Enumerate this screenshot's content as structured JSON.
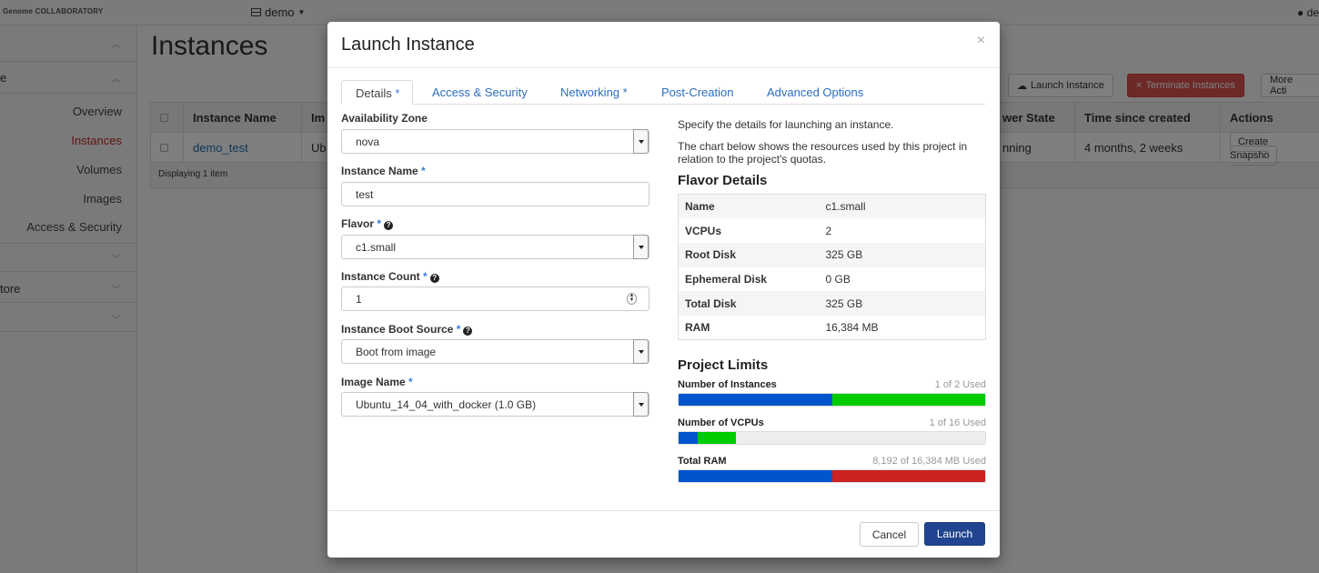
{
  "topbar": {
    "brand": "Genome COLLABORATORY",
    "project": "demo",
    "user": "de"
  },
  "sidebar": {
    "project_label": "e",
    "items": [
      "Overview",
      "Instances",
      "Volumes",
      "Images",
      "Access & Security"
    ],
    "object_store_label": "tore"
  },
  "page": {
    "title": "Instances",
    "launch_button": "Launch Instance",
    "terminate_button": "Terminate Instances",
    "more_button": "More Acti",
    "table": {
      "headers": [
        "Instance Name",
        "Im",
        "wer State",
        "Time since created",
        "Actions"
      ],
      "row": {
        "name": "demo_test",
        "image": "Ub",
        "power": "nning",
        "time": "4 months, 2 weeks",
        "action": "Create Snapsho"
      },
      "footer": "Displaying 1 item"
    }
  },
  "modal": {
    "title": "Launch Instance",
    "close": "×",
    "tabs": [
      "Details",
      "Access & Security",
      "Networking",
      "Post-Creation",
      "Advanced Options"
    ],
    "required_mark": "*",
    "fields": {
      "availability_zone": {
        "label": "Availability Zone",
        "value": "nova"
      },
      "instance_name": {
        "label": "Instance Name",
        "value": "test"
      },
      "flavor": {
        "label": "Flavor",
        "value": "c1.small"
      },
      "instance_count": {
        "label": "Instance Count",
        "value": "1"
      },
      "boot_source": {
        "label": "Instance Boot Source",
        "value": "Boot from image"
      },
      "image_name": {
        "label": "Image Name",
        "value": "Ubuntu_14_04_with_docker (1.0 GB)"
      }
    },
    "help": {
      "intro": "Specify the details for launching an instance.",
      "chart_note": "The chart below shows the resources used by this project in relation to the project's quotas."
    },
    "flavor_details": {
      "title": "Flavor Details",
      "rows": [
        {
          "k": "Name",
          "v": "c1.small"
        },
        {
          "k": "VCPUs",
          "v": "2"
        },
        {
          "k": "Root Disk",
          "v": "325 GB"
        },
        {
          "k": "Ephemeral Disk",
          "v": "0 GB"
        },
        {
          "k": "Total Disk",
          "v": "325 GB"
        },
        {
          "k": "RAM",
          "v": "16,384 MB"
        }
      ]
    },
    "limits": {
      "title": "Project Limits",
      "instances": {
        "label": "Number of Instances",
        "used_text": "1 of 2 Used",
        "current": 0.5,
        "added": 0.5,
        "added_color": "#00cc00"
      },
      "vcpus": {
        "label": "Number of VCPUs",
        "used_text": "1 of 16 Used",
        "current": 0.0625,
        "added": 0.125,
        "added_color": "#00cc00"
      },
      "ram": {
        "label": "Total RAM",
        "used_text": "8,192 of 16,384 MB Used",
        "current": 0.5,
        "added": 0.5,
        "added_color": "#cc2222"
      }
    },
    "colors": {
      "current": "#0055cc",
      "accent": "#20448f"
    },
    "buttons": {
      "cancel": "Cancel",
      "launch": "Launch"
    }
  }
}
